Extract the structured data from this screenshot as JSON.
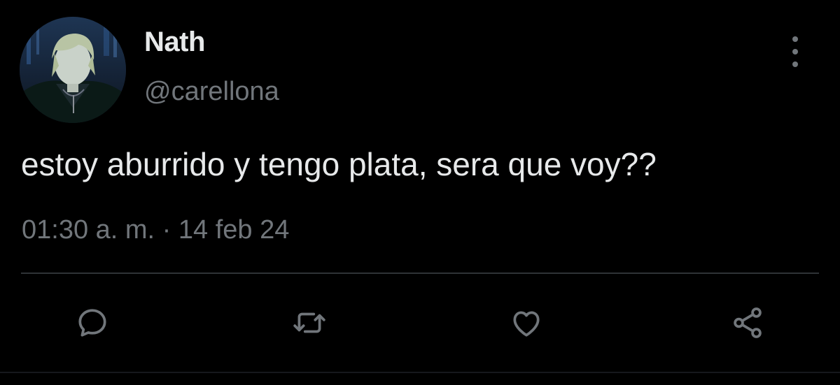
{
  "tweet": {
    "author": {
      "display_name": "Nath",
      "handle": "@carellona",
      "avatar_icon": "anime-character-avatar"
    },
    "text": "estoy aburrido y tengo plata, sera que voy??",
    "timestamp": "01:30 a. m. · 14 feb 24",
    "menu_icon": "more-vertical-icon",
    "actions": [
      {
        "name": "reply",
        "icon": "reply-icon"
      },
      {
        "name": "retweet",
        "icon": "retweet-icon"
      },
      {
        "name": "like",
        "icon": "heart-icon"
      },
      {
        "name": "share",
        "icon": "share-icon"
      }
    ]
  },
  "colors": {
    "background": "#000000",
    "primary_text": "#e7e9ea",
    "secondary_text": "#71767b",
    "divider": "#2f3336"
  }
}
